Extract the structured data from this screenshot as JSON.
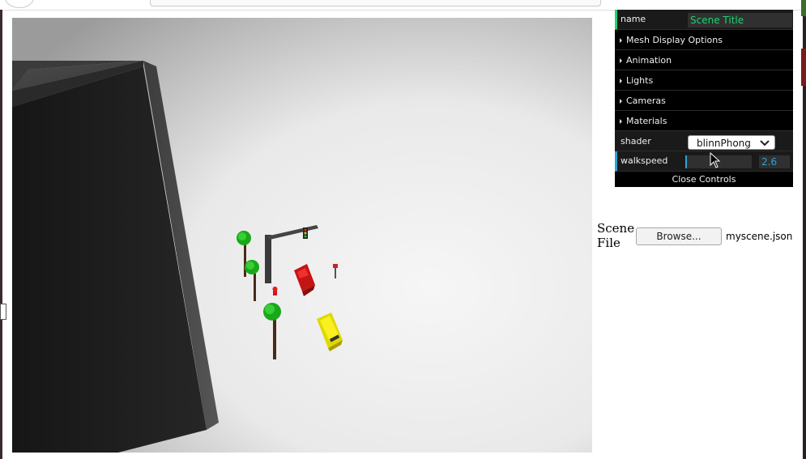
{
  "gui": {
    "name_label": "name",
    "name_value": "Scene Title",
    "folders": [
      {
        "label": "Mesh Display Options"
      },
      {
        "label": "Animation"
      },
      {
        "label": "Lights"
      },
      {
        "label": "Cameras"
      },
      {
        "label": "Materials"
      }
    ],
    "shader_label": "shader",
    "shader_value": "blinnPhong",
    "walkspeed_label": "walkspeed",
    "walkspeed_value": "2.6",
    "close_label": "Close Controls",
    "colors": {
      "string_accent": "#1ed36f",
      "number_accent": "#2fa1d6",
      "panel_bg": "#1a1a1a"
    }
  },
  "scene_file": {
    "label": "Scene File",
    "browse_label": "Browse...",
    "file_name": "myscene.json"
  },
  "icons": [
    "caret-right-icon",
    "chevron-down-icon",
    "mouse-cursor-icon"
  ]
}
